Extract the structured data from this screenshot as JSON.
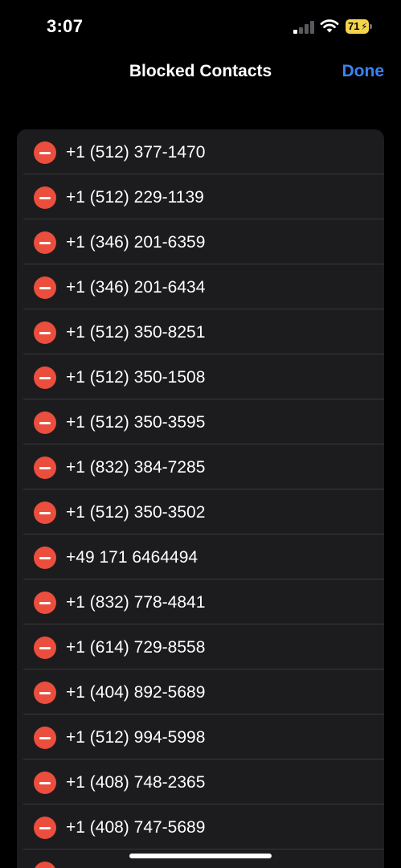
{
  "status_bar": {
    "time": "3:07",
    "battery_level": "71",
    "signal_bars_active": 1,
    "signal_bars_total": 4
  },
  "nav": {
    "title": "Blocked Contacts",
    "done_label": "Done",
    "accent_color": "#3b82f6"
  },
  "colors": {
    "delete": "#eb4e3d",
    "list_background": "#1c1c1e",
    "separator": "#38383a",
    "battery": "#f5d34c"
  },
  "blocked_contacts": [
    "+1 (512) 377-1470",
    "+1 (512) 229-1139",
    "+1 (346) 201-6359",
    "+1 (346) 201-6434",
    "+1 (512) 350-8251",
    "+1 (512) 350-1508",
    "+1 (512) 350-3595",
    "+1 (832) 384-7285",
    "+1 (512) 350-3502",
    "+49 171 6464494",
    "+1 (832) 778-4841",
    "+1 (614) 729-8558",
    "+1 (404) 892-5689",
    "+1 (512) 994-5998",
    "+1 (408) 748-2365",
    "+1 (408) 747-5689"
  ]
}
